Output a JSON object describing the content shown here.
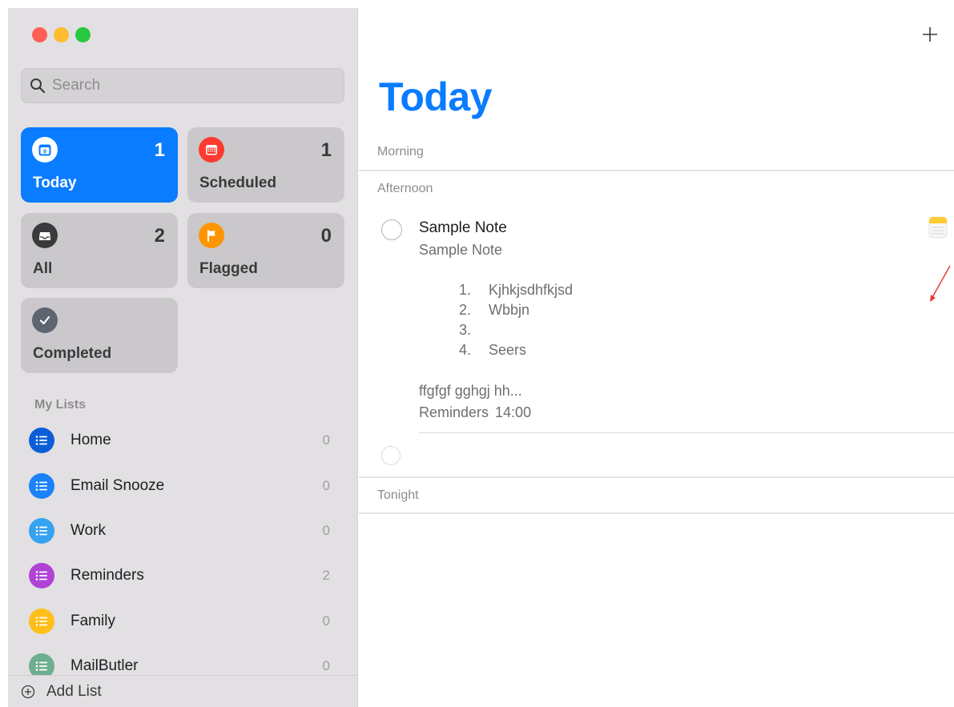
{
  "sidebar": {
    "window_controls": [
      "close",
      "minimize",
      "zoom"
    ],
    "search": {
      "placeholder": "Search",
      "icon": "search-icon"
    },
    "smart_lists": [
      {
        "label": "Today",
        "count": "1",
        "icon": "calendar-today-icon",
        "color": "#0a7cff",
        "active": true
      },
      {
        "label": "Scheduled",
        "count": "1",
        "icon": "calendar-icon",
        "color": "#ff3b30",
        "active": false
      },
      {
        "label": "All",
        "count": "2",
        "icon": "tray-icon",
        "color": "#3a3a3c",
        "active": false
      },
      {
        "label": "Flagged",
        "count": "0",
        "icon": "flag-icon",
        "color": "#ff9500",
        "active": false
      },
      {
        "label": "Completed",
        "icon": "checkmark-icon",
        "color": "#5e6470",
        "active": false
      }
    ],
    "my_lists_title": "My Lists",
    "lists": [
      {
        "name": "Home",
        "count": "0",
        "color": "#0b5ed7",
        "icon": "list-icon"
      },
      {
        "name": "Email Snooze",
        "count": "0",
        "color": "#1a82fb",
        "icon": "list-icon"
      },
      {
        "name": "Work",
        "count": "0",
        "color": "#35a3f0",
        "icon": "list-icon"
      },
      {
        "name": "Reminders",
        "count": "2",
        "color": "#b042d6",
        "icon": "list-icon"
      },
      {
        "name": "Family",
        "count": "0",
        "color": "#ffbf1a",
        "icon": "list-icon"
      },
      {
        "name": "MailButler",
        "count": "0",
        "color": "#6fae90",
        "icon": "list-icon"
      }
    ],
    "add_list_label": "Add List"
  },
  "main": {
    "title": "Today",
    "sections": {
      "morning": "Morning",
      "afternoon": "Afternoon",
      "tonight": "Tonight"
    },
    "reminder": {
      "title": "Sample Note",
      "note": "Sample Note",
      "list_items": [
        {
          "num": "1.",
          "text": "Kjhkjsdhfkjsd"
        },
        {
          "num": "2.",
          "text": "Wbbjn"
        },
        {
          "num": "3.",
          "text": ""
        },
        {
          "num": "4.",
          "text": "Seers"
        }
      ],
      "extra": "ffgfgf gghgj hh...",
      "list_name": "Reminders",
      "time": "14:00",
      "attachment_icon": "notes-app-icon"
    }
  },
  "colors": {
    "accent": "#0a7cff",
    "sidebar_bg": "#e2e0e2",
    "annotation_arrow": "#e53935"
  }
}
